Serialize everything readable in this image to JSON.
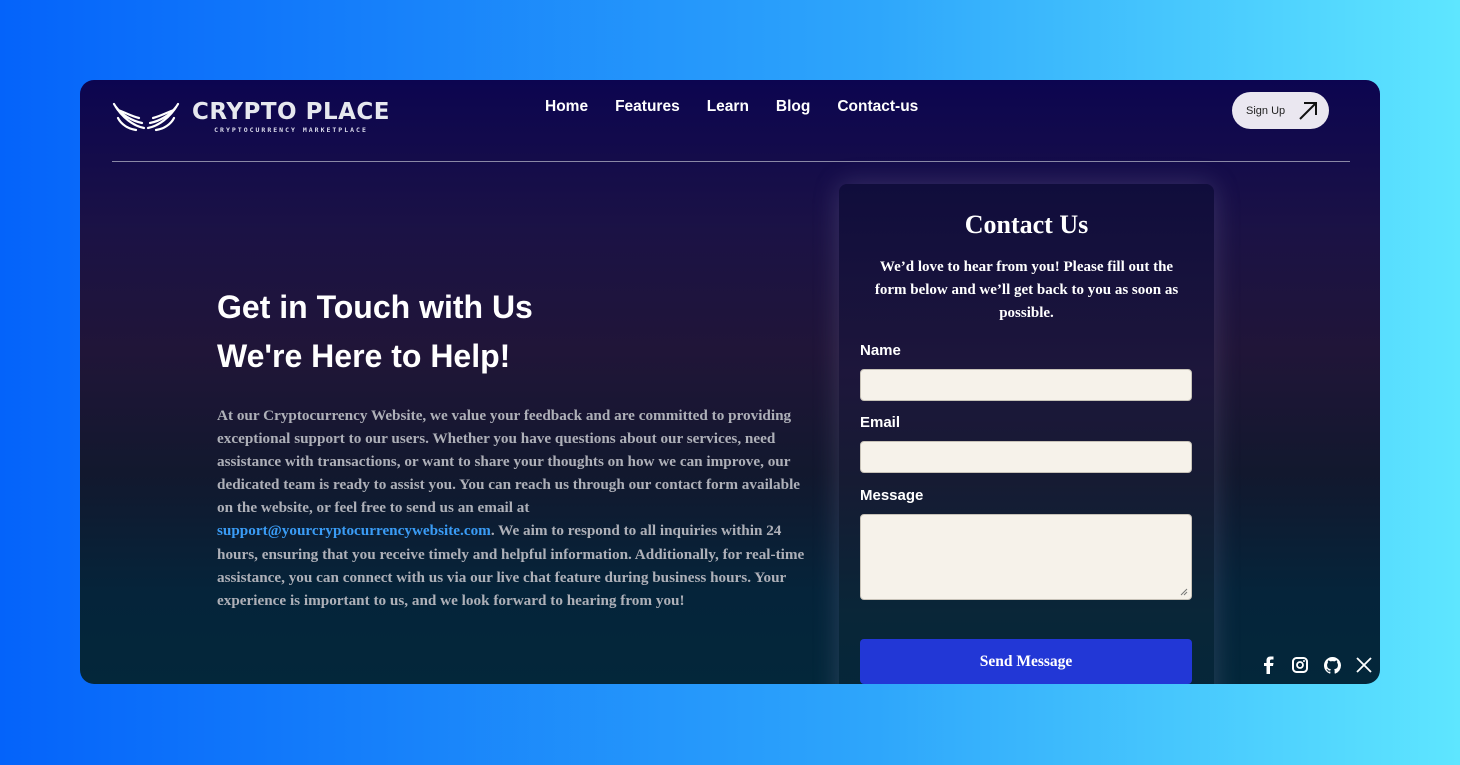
{
  "brand": {
    "title": "CRYPTO PLACE",
    "subtitle": "CRYPTOCURRENCY MARKETPLACE"
  },
  "nav": [
    "Home",
    "Features",
    "Learn",
    "Blog",
    "Contact-us"
  ],
  "signup": {
    "label": "Sign Up",
    "icon": "arrow-up-right-icon"
  },
  "hero": {
    "heading_1": "Get in Touch with Us",
    "heading_2": "We're Here to Help!",
    "para_before": "At our Cryptocurrency Website, we value your feedback and are committed to providing exceptional support to our users. Whether you have questions about our services, need assistance with transactions, or want to share your thoughts on how we can improve, our dedicated team is ready to assist you. You can reach us through our contact form available on the website, or feel free to send us an email at ",
    "email": "support@yourcryptocurrencywebsite.com",
    "para_after": ". We aim to respond to all inquiries within 24 hours, ensuring that you receive timely and helpful information. Additionally, for real-time assistance, you can connect with us via our live chat feature during business hours. Your experience is important to us, and we look forward to hearing from you!"
  },
  "form": {
    "title": "Contact Us",
    "description": "We’d love to hear from you! Please fill out the form below and we’ll get back to you as soon as possible.",
    "name_label": "Name",
    "email_label": "Email",
    "message_label": "Message",
    "name_value": "",
    "email_value": "",
    "message_value": "",
    "submit_label": "Send Message"
  },
  "social": [
    "facebook-icon",
    "instagram-icon",
    "github-icon",
    "x-icon"
  ],
  "colors": {
    "accent": "#2237d6",
    "link": "#3a9cf6",
    "field_bg": "#f6f2ea"
  }
}
